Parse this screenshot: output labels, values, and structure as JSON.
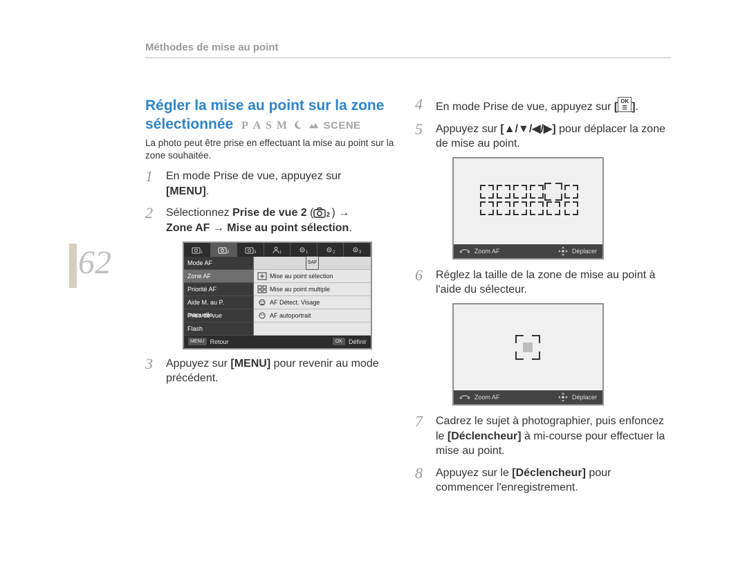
{
  "header": {
    "section_title": "Méthodes de mise au point"
  },
  "page_number": "62",
  "title_line1": "Régler la mise au point sur la zone",
  "title_line2": "sélectionnée",
  "modes": {
    "p": "P",
    "a": "A",
    "s": "S",
    "m": "M",
    "scene": "SCENE"
  },
  "intro": "La photo peut être prise en effectuant la mise au point sur la zone souhaitée.",
  "steps_left": {
    "s1": {
      "n": "1",
      "pre": "En mode Prise de vue, appuyez sur ",
      "menu": "[MENU]",
      "post": "."
    },
    "s2": {
      "n": "2",
      "a": "Sélectionnez ",
      "b": "Prise de vue 2",
      "c": " (",
      "d": ")  →",
      "e": "Zone AF → Mise au point sélection",
      "f": "."
    },
    "s3": {
      "n": "3",
      "a": "Appuyez sur ",
      "b": "[MENU]",
      "c": " pour revenir au mode précédent."
    }
  },
  "steps_right": {
    "s4": {
      "n": "4",
      "a": "En mode Prise de vue, appuyez sur ",
      "ok_top": "OK",
      "ok_bot": "☰",
      "b": "."
    },
    "s5": {
      "n": "5",
      "a": "Appuyez sur ",
      "keys": "[▲/▼/◀/▶]",
      "b": " pour déplacer la zone de mise au point."
    },
    "s6": {
      "n": "6",
      "a": "Réglez la taille de la zone de mise au point à l'aide du sélecteur."
    },
    "s7": {
      "n": "7",
      "a": "Cadrez le sujet à photographier, puis enfoncez le ",
      "b": "[Déclencheur]",
      "c": " à mi-course pour effectuer la mise au point."
    },
    "s8": {
      "n": "8",
      "a": "Appuyez sur le ",
      "b": "[Déclencheur]",
      "c": " pour commencer l'enregistrement."
    }
  },
  "menu_shot": {
    "tabs": [
      "1",
      "2",
      "3",
      "1",
      "1",
      "2",
      "3"
    ],
    "list": [
      "Mode AF",
      "Zone AF",
      "Priorité AF",
      "Aide M. au P. manuelle",
      "Prise de vue",
      "Flash"
    ],
    "selected_list_index": 1,
    "opts_head": "SAF",
    "opts": [
      "Mise au point sélection",
      "Mise au point multiple",
      "AF Détect. Visage",
      "AF autoportrait"
    ],
    "footer_left_btn": "MENU",
    "footer_left": "Retour",
    "footer_right_btn": "OK",
    "footer_right": "Définir"
  },
  "vf_footer": {
    "left": "Zoom AF",
    "right": "Déplacer"
  }
}
